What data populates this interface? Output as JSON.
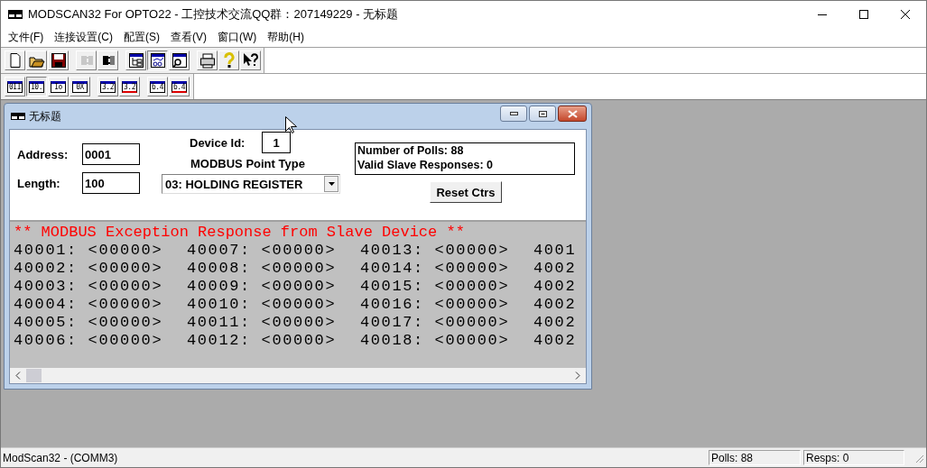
{
  "window": {
    "title": "MODSCAN32 For OPTO22 - 工控技术交流QQ群：207149229 - 无标题"
  },
  "menu": [
    "文件(F)",
    "连接设置(C)",
    "配置(S)",
    "查看(V)",
    "窗口(W)",
    "帮助(H)"
  ],
  "toolbar": [
    [
      {
        "kind": "new",
        "selected": false,
        "disabled": false
      },
      {
        "kind": "open",
        "selected": false,
        "disabled": false
      },
      {
        "kind": "save",
        "selected": false,
        "disabled": false
      }
    ],
    [
      {
        "kind": "connect",
        "selected": false,
        "disabled": true
      },
      {
        "kind": "disconnect",
        "selected": false,
        "disabled": false
      }
    ],
    [
      {
        "kind": "tree",
        "selected": false,
        "disabled": false
      },
      {
        "kind": "display",
        "selected": true,
        "disabled": false
      },
      {
        "kind": "find",
        "selected": false,
        "disabled": false
      }
    ],
    [
      {
        "kind": "print",
        "selected": false,
        "disabled": false
      },
      {
        "kind": "help",
        "selected": false,
        "disabled": false
      },
      {
        "kind": "context_help",
        "selected": false,
        "disabled": false
      }
    ]
  ],
  "format_toolbar": [
    [
      {
        "label": "0II",
        "selected": false,
        "struck": false
      },
      {
        "label": "10.",
        "selected": true,
        "struck": false
      },
      {
        "label": "Io",
        "selected": false,
        "struck": false
      },
      {
        "label": "0X",
        "selected": false,
        "struck": false
      }
    ],
    [
      {
        "label": "3.2",
        "selected": false,
        "struck": false
      },
      {
        "label": "3.2",
        "selected": false,
        "struck": true
      }
    ],
    [
      {
        "label": "6.4",
        "selected": false,
        "struck": false
      },
      {
        "label": "6.4",
        "selected": false,
        "struck": true
      }
    ]
  ],
  "child_window": {
    "title": "无标题",
    "address": {
      "label": "Address:",
      "value": "0001"
    },
    "length": {
      "label": "Length:",
      "value": "100"
    },
    "device_id": {
      "label": "Device Id:",
      "value": "1"
    },
    "point_type": {
      "label": "MODBUS Point Type",
      "value": "03: HOLDING REGISTER"
    },
    "stats": [
      "Number of Polls: 88",
      "Valid Slave Responses: 0"
    ],
    "reset_button": "Reset Ctrs",
    "message": "** MODBUS Exception Response from Slave Device **",
    "rows": [
      [
        "40001: <00000>",
        "40007: <00000>",
        "40013: <00000>",
        "4001"
      ],
      [
        "40002: <00000>",
        "40008: <00000>",
        "40014: <00000>",
        "4002"
      ],
      [
        "40003: <00000>",
        "40009: <00000>",
        "40015: <00000>",
        "4002"
      ],
      [
        "40004: <00000>",
        "40010: <00000>",
        "40016: <00000>",
        "4002"
      ],
      [
        "40005: <00000>",
        "40011: <00000>",
        "40017: <00000>",
        "4002"
      ],
      [
        "40006: <00000>",
        "40012: <00000>",
        "40018: <00000>",
        "4002"
      ]
    ]
  },
  "status_bar": {
    "text": "ModScan32 - (COMM3)",
    "polls": "Polls: 88",
    "resps": "Resps: 0"
  }
}
